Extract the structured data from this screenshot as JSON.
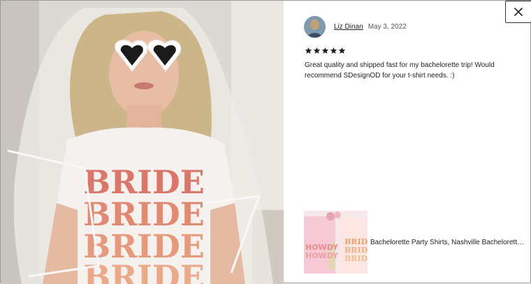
{
  "review": {
    "reviewer_name": "Liz Dinan",
    "date": "May 3, 2022",
    "rating": 5,
    "text": "Great quality and shipped fast for my bachelorette trip! Would recommend SDesignOD for your t-shirt needs. :)"
  },
  "listing": {
    "title": "Bachelorette Party Shirts, Nashville Bachelorette S..."
  },
  "photo": {
    "shirt_text": "BRIDE"
  },
  "icons": {
    "close": "close-icon",
    "star": "star-icon"
  },
  "colors": {
    "star": "#222222",
    "border": "#333333"
  }
}
